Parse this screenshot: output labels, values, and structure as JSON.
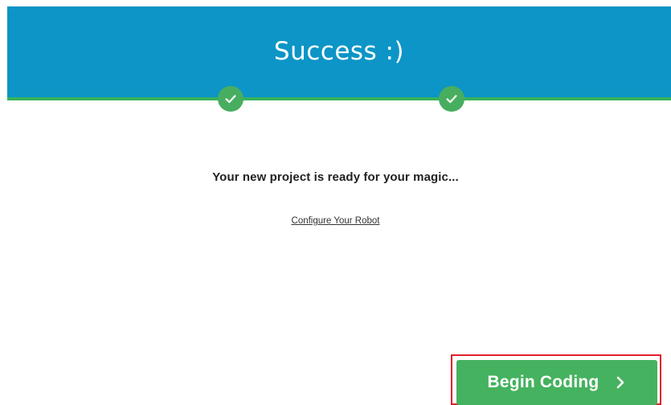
{
  "header": {
    "title": "Success :)",
    "color": "#0c95c6"
  },
  "progress": {
    "steps": [
      {
        "status": "complete",
        "icon": "checkmark-icon"
      },
      {
        "status": "complete",
        "icon": "checkmark-icon"
      }
    ],
    "accent": "#36b25c"
  },
  "main": {
    "message": "Your new project is ready for your magic...",
    "configure_link": "Configure Your Robot"
  },
  "footer": {
    "begin_label": "Begin Coding",
    "begin_icon": "chevron-right-icon",
    "button_color": "#45b25f",
    "highlight_color": "#e0202a"
  }
}
